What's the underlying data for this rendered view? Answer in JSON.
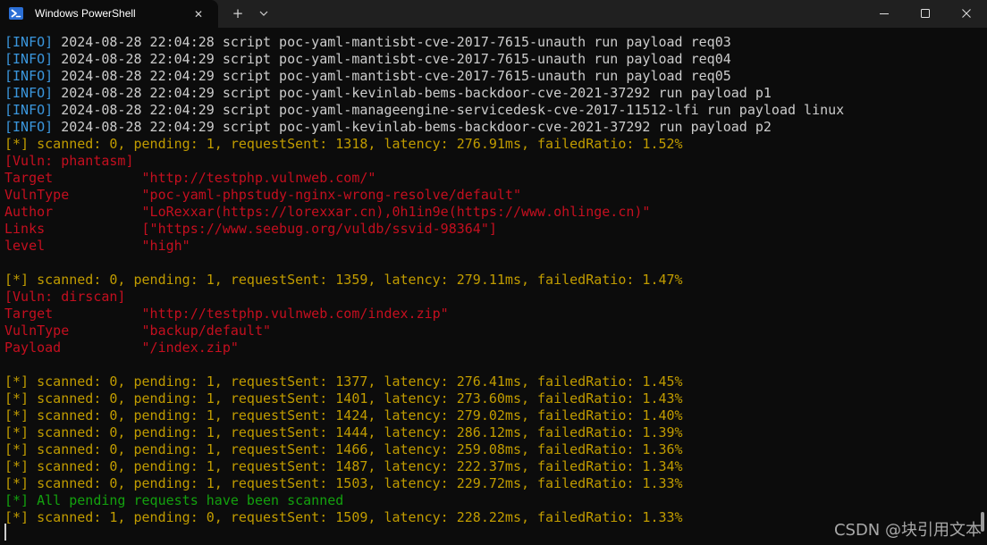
{
  "window": {
    "tab_title": "Windows PowerShell",
    "tab_close_glyph": "✕",
    "new_tab_glyph": "+",
    "icons": {
      "tab_icon": "powershell-icon",
      "dropdown": "chevron-down-icon",
      "minimize": "minimize-icon",
      "maximize": "maximize-icon",
      "close": "close-icon"
    }
  },
  "colors": {
    "background": "#0c0c0c",
    "info": "#3a96dd",
    "text": "#cccccc",
    "status": "#c19c00",
    "vuln": "#c50f1f",
    "success": "#13a10e"
  },
  "terminal": {
    "lines": [
      {
        "style": "info",
        "tag": "[INFO]",
        "text": " 2024-08-28 22:04:28 script poc-yaml-mantisbt-cve-2017-7615-unauth run payload req03"
      },
      {
        "style": "info",
        "tag": "[INFO]",
        "text": " 2024-08-28 22:04:29 script poc-yaml-mantisbt-cve-2017-7615-unauth run payload req04"
      },
      {
        "style": "info",
        "tag": "[INFO]",
        "text": " 2024-08-28 22:04:29 script poc-yaml-mantisbt-cve-2017-7615-unauth run payload req05"
      },
      {
        "style": "info",
        "tag": "[INFO]",
        "text": " 2024-08-28 22:04:29 script poc-yaml-kevinlab-bems-backdoor-cve-2021-37292 run payload p1"
      },
      {
        "style": "info",
        "tag": "[INFO]",
        "text": " 2024-08-28 22:04:29 script poc-yaml-manageengine-servicedesk-cve-2017-11512-lfi run payload linux"
      },
      {
        "style": "info",
        "tag": "[INFO]",
        "text": " 2024-08-28 22:04:29 script poc-yaml-kevinlab-bems-backdoor-cve-2021-37292 run payload p2"
      },
      {
        "style": "yellow",
        "text": "[*] scanned: 0, pending: 1, requestSent: 1318, latency: 276.91ms, failedRatio: 1.52%"
      },
      {
        "style": "red",
        "text": "[Vuln: phantasm]"
      },
      {
        "style": "red",
        "text": "Target           \"http://testphp.vulnweb.com/\""
      },
      {
        "style": "red",
        "text": "VulnType         \"poc-yaml-phpstudy-nginx-wrong-resolve/default\""
      },
      {
        "style": "red",
        "text": "Author           \"LoRexxar(https://lorexxar.cn),0h1in9e(https://www.ohlinge.cn)\""
      },
      {
        "style": "red",
        "text": "Links            [\"https://www.seebug.org/vuldb/ssvid-98364\"]"
      },
      {
        "style": "red",
        "text": "level            \"high\""
      },
      {
        "style": "blank",
        "text": ""
      },
      {
        "style": "yellow",
        "text": "[*] scanned: 0, pending: 1, requestSent: 1359, latency: 279.11ms, failedRatio: 1.47%"
      },
      {
        "style": "red",
        "text": "[Vuln: dirscan]"
      },
      {
        "style": "red",
        "text": "Target           \"http://testphp.vulnweb.com/index.zip\""
      },
      {
        "style": "red",
        "text": "VulnType         \"backup/default\""
      },
      {
        "style": "red",
        "text": "Payload          \"/index.zip\""
      },
      {
        "style": "blank",
        "text": ""
      },
      {
        "style": "yellow",
        "text": "[*] scanned: 0, pending: 1, requestSent: 1377, latency: 276.41ms, failedRatio: 1.45%"
      },
      {
        "style": "yellow",
        "text": "[*] scanned: 0, pending: 1, requestSent: 1401, latency: 273.60ms, failedRatio: 1.43%"
      },
      {
        "style": "yellow",
        "text": "[*] scanned: 0, pending: 1, requestSent: 1424, latency: 279.02ms, failedRatio: 1.40%"
      },
      {
        "style": "yellow",
        "text": "[*] scanned: 0, pending: 1, requestSent: 1444, latency: 286.12ms, failedRatio: 1.39%"
      },
      {
        "style": "yellow",
        "text": "[*] scanned: 0, pending: 1, requestSent: 1466, latency: 259.08ms, failedRatio: 1.36%"
      },
      {
        "style": "yellow",
        "text": "[*] scanned: 0, pending: 1, requestSent: 1487, latency: 222.37ms, failedRatio: 1.34%"
      },
      {
        "style": "yellow",
        "text": "[*] scanned: 0, pending: 1, requestSent: 1503, latency: 229.72ms, failedRatio: 1.33%"
      },
      {
        "style": "green",
        "text": "[*] All pending requests have been scanned"
      },
      {
        "style": "yellow",
        "text": "[*] scanned: 1, pending: 0, requestSent: 1509, latency: 228.22ms, failedRatio: 1.33%"
      }
    ]
  },
  "watermark": "CSDN @块引用文本"
}
